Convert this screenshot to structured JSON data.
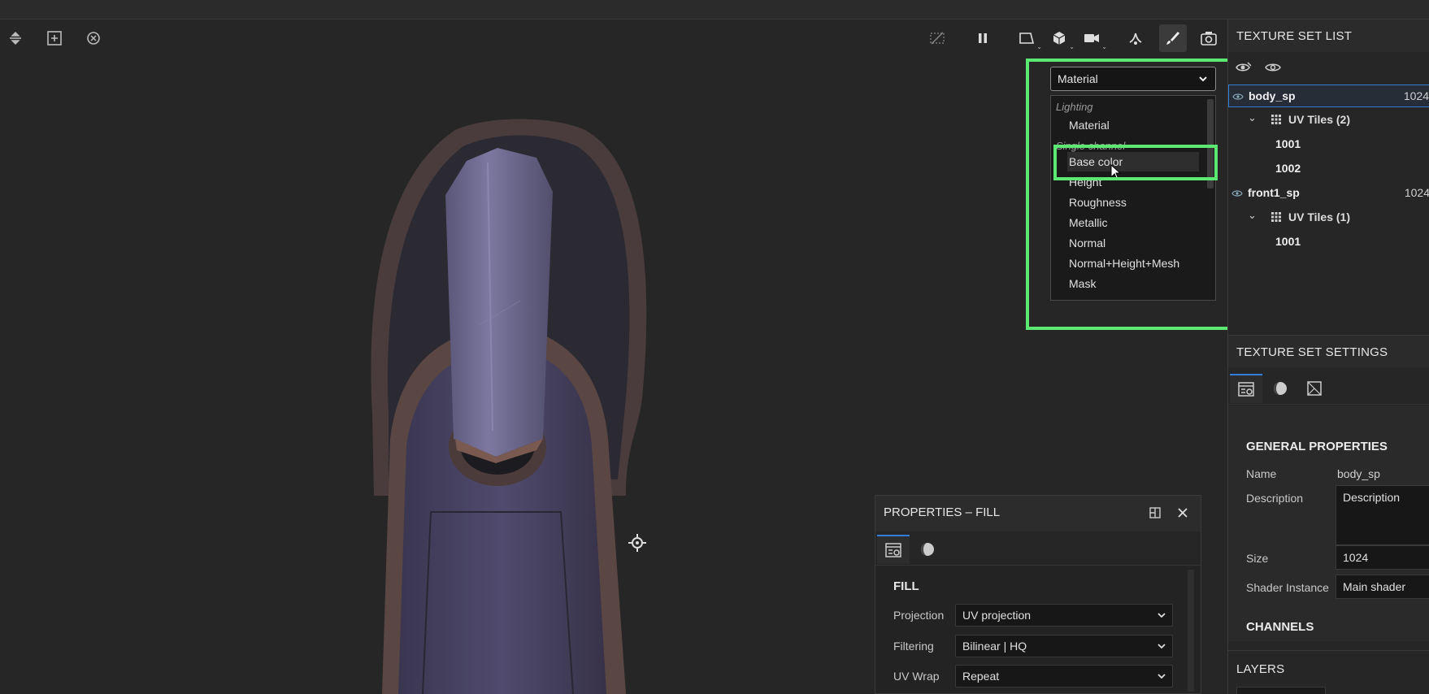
{
  "toolbar": {
    "left_icons": [
      "align-icon",
      "add-frame-icon",
      "reset-camera-icon"
    ],
    "right_icons": [
      "hide-icon",
      "pause-icon",
      "2d-view-icon",
      "3d-view-icon",
      "camera-icon",
      "symmetry-icon",
      "paint-brush-icon",
      "screenshot-icon"
    ]
  },
  "viewport_mode": {
    "selected": "Material",
    "groups": [
      {
        "label": "Lighting",
        "options": [
          "Material"
        ]
      },
      {
        "label": "Single channel",
        "options": [
          "Base color",
          "Height",
          "Roughness",
          "Metallic",
          "Normal",
          "Normal+Height+Mesh",
          "Mask"
        ]
      }
    ],
    "hovered": "Base color",
    "highlight_color": "#5be873"
  },
  "properties_panel": {
    "title": "PROPERTIES – FILL",
    "section": "FILL",
    "rows": [
      {
        "label": "Projection",
        "value": "UV projection"
      },
      {
        "label": "Filtering",
        "value": "Bilinear | HQ"
      },
      {
        "label": "UV Wrap",
        "value": "Repeat"
      }
    ]
  },
  "texture_set_list": {
    "title": "TEXTURE SET LIST",
    "sets": [
      {
        "name": "body_sp",
        "size": "1024",
        "tiles_label": "UV Tiles (2)",
        "tiles": [
          "1001",
          "1002"
        ]
      },
      {
        "name": "front1_sp",
        "size": "1024",
        "tiles_label": "UV Tiles (1)",
        "tiles": [
          "1001"
        ]
      }
    ]
  },
  "texture_set_settings": {
    "title": "TEXTURE SET SETTINGS",
    "general_title": "GENERAL PROPERTIES",
    "name_label": "Name",
    "name_value": "body_sp",
    "description_label": "Description",
    "description_value": "Description",
    "size_label": "Size",
    "size_value": "1024",
    "shader_label": "Shader Instance",
    "shader_value": "Main shader",
    "channels_title": "CHANNELS"
  },
  "layers": {
    "title": "LAYERS"
  },
  "colors": {
    "accent": "#2f7fd8",
    "highlight": "#5be873"
  }
}
